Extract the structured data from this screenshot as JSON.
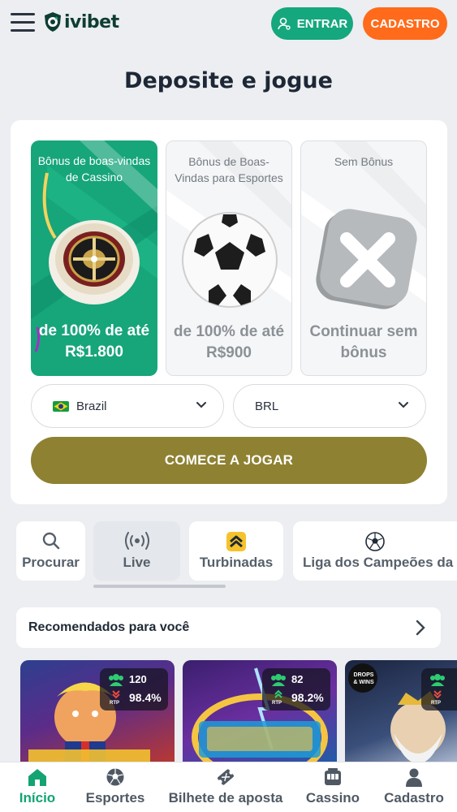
{
  "header": {
    "brand": "ivibet",
    "login_label": "ENTRAR",
    "register_label": "CADASTRO"
  },
  "page": {
    "title": "Deposite e jogue"
  },
  "bonuses": [
    {
      "title": "Bônus de boas-vindas de Cassino",
      "value": "de 100% de até R$1.800",
      "selected": true
    },
    {
      "title": "Bônus de Boas-Vindas para Esportes",
      "value": "de 100% de até R$900",
      "selected": false
    },
    {
      "title": "Sem Bônus",
      "value": "Continuar sem bônus",
      "selected": false
    }
  ],
  "form": {
    "country": "Brazil",
    "currency": "BRL",
    "cta_label": "COMECE A JOGAR"
  },
  "categories": [
    {
      "label": "Procurar",
      "icon": "search-icon"
    },
    {
      "label": "Live",
      "icon": "broadcast-icon"
    },
    {
      "label": "Turbinadas",
      "icon": "boost-icon"
    },
    {
      "label": "Liga dos Campeões da",
      "icon": "football-icon"
    }
  ],
  "recommended": {
    "title": "Recomendados para você",
    "games": [
      {
        "players": "120",
        "rtp": "98.4%",
        "rtp_label": "RTP",
        "trend": "down",
        "theme_color": "#c0392b"
      },
      {
        "players": "82",
        "rtp": "98.2%",
        "rtp_label": "RTP",
        "trend": "up",
        "theme_color": "#6a2fa0"
      },
      {
        "players": "",
        "rtp": "",
        "rtp_label": "RTP",
        "trend": "down",
        "theme_color": "#3a4f7a",
        "badge": "DROPS & WINS"
      }
    ]
  },
  "bottom_nav": [
    {
      "label": "Início",
      "icon": "home-icon",
      "active": true
    },
    {
      "label": "Esportes",
      "icon": "soccer-ball-icon",
      "active": false
    },
    {
      "label": "Bilhete de aposta",
      "icon": "ticket-icon",
      "active": false
    },
    {
      "label": "Cassino",
      "icon": "slot-machine-icon",
      "active": false
    },
    {
      "label": "Cadastro",
      "icon": "user-icon",
      "active": false
    }
  ],
  "colors": {
    "brand_green": "#15a77d",
    "accent_orange": "#ff6b1a",
    "cta_olive": "#8e8132"
  }
}
